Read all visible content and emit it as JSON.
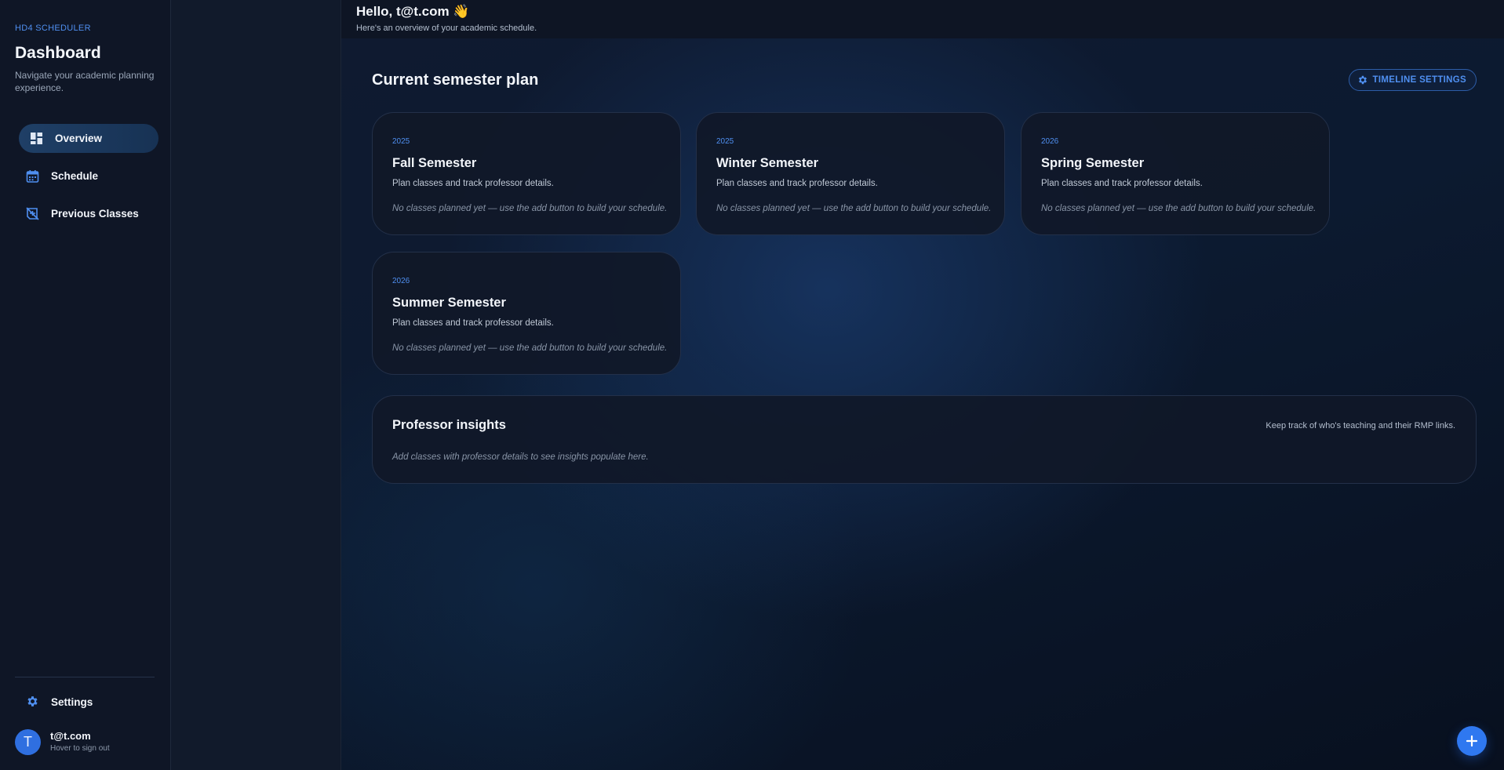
{
  "sidebar": {
    "brand": "HD4 SCHEDULER",
    "title": "Dashboard",
    "description": "Navigate your academic planning experience.",
    "nav": [
      {
        "label": "Overview",
        "icon": "dashboard-icon",
        "active": true
      },
      {
        "label": "Schedule",
        "icon": "calendar-icon",
        "active": false
      },
      {
        "label": "Previous Classes",
        "icon": "history-icon",
        "active": false
      }
    ],
    "settings_label": "Settings",
    "user": {
      "initial": "T",
      "name": "t@t.com",
      "hint": "Hover to sign out"
    }
  },
  "header": {
    "greeting": "Hello, t@t.com 👋",
    "subtitle": "Here's an overview of your academic schedule."
  },
  "main": {
    "section_title": "Current semester plan",
    "timeline_button": "TIMELINE SETTINGS",
    "semesters": [
      {
        "year": "2025",
        "title": "Fall Semester",
        "description": "Plan classes and track professor details.",
        "empty": "No classes planned yet — use the add button to build your schedule."
      },
      {
        "year": "2025",
        "title": "Winter Semester",
        "description": "Plan classes and track professor details.",
        "empty": "No classes planned yet — use the add button to build your schedule."
      },
      {
        "year": "2026",
        "title": "Spring Semester",
        "description": "Plan classes and track professor details.",
        "empty": "No classes planned yet — use the add button to build your schedule."
      },
      {
        "year": "2026",
        "title": "Summer Semester",
        "description": "Plan classes and track professor details.",
        "empty": "No classes planned yet — use the add button to build your schedule."
      }
    ],
    "insights": {
      "title": "Professor insights",
      "note": "Keep track of who's teaching and their RMP links.",
      "empty": "Add classes with professor details to see insights populate here."
    }
  },
  "colors": {
    "accent": "#4f8ff0",
    "fab": "#2f78f0",
    "background": "#0f1626"
  }
}
